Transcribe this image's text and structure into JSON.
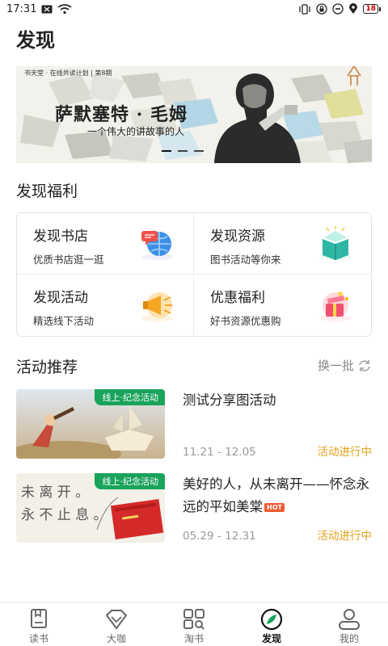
{
  "status": {
    "time": "17:31",
    "battery": "18"
  },
  "page": {
    "title": "发现"
  },
  "banner": {
    "series": "书天堂 · 在线共读计划 | 第8期",
    "title": "萨默塞特 · 毛姆",
    "subtitle": "一个伟大的讲故事的人"
  },
  "welfare": {
    "title": "发现福利",
    "items": [
      {
        "title": "发现书店",
        "subtitle": "优质书店逛一逛",
        "icon": "globe-chat-icon"
      },
      {
        "title": "发现资源",
        "subtitle": "图书活动等你来",
        "icon": "open-book-icon"
      },
      {
        "title": "发现活动",
        "subtitle": "精选线下活动",
        "icon": "megaphone-icon"
      },
      {
        "title": "优惠福利",
        "subtitle": "好书资源优惠购",
        "icon": "gift-box-icon"
      }
    ]
  },
  "activities": {
    "title": "活动推荐",
    "swap_label": "换一批",
    "items": [
      {
        "tag": "线上·纪念活动",
        "title": "测试分享图活动",
        "date": "11.21 - 12.05",
        "status": "活动进行中"
      },
      {
        "tag": "线上·纪念活动",
        "title": "美好的人，从未离开——怀念永远的平如美棠",
        "hot": "HOT",
        "date": "05.29 - 12.31",
        "status": "活动进行中",
        "thumb_text_1": "未 离 开 。",
        "thumb_text_2": "永 不 止 息 。"
      }
    ]
  },
  "nav": {
    "items": [
      {
        "label": "读书",
        "icon": "book-icon"
      },
      {
        "label": "大咖",
        "icon": "diamond-icon"
      },
      {
        "label": "淘书",
        "icon": "grid-search-icon"
      },
      {
        "label": "发现",
        "icon": "compass-icon",
        "active": true
      },
      {
        "label": "我的",
        "icon": "person-icon"
      }
    ]
  },
  "colors": {
    "accent_green": "#19a35b",
    "status_orange": "#e3a217",
    "hot_red": "#ee5a2e"
  }
}
